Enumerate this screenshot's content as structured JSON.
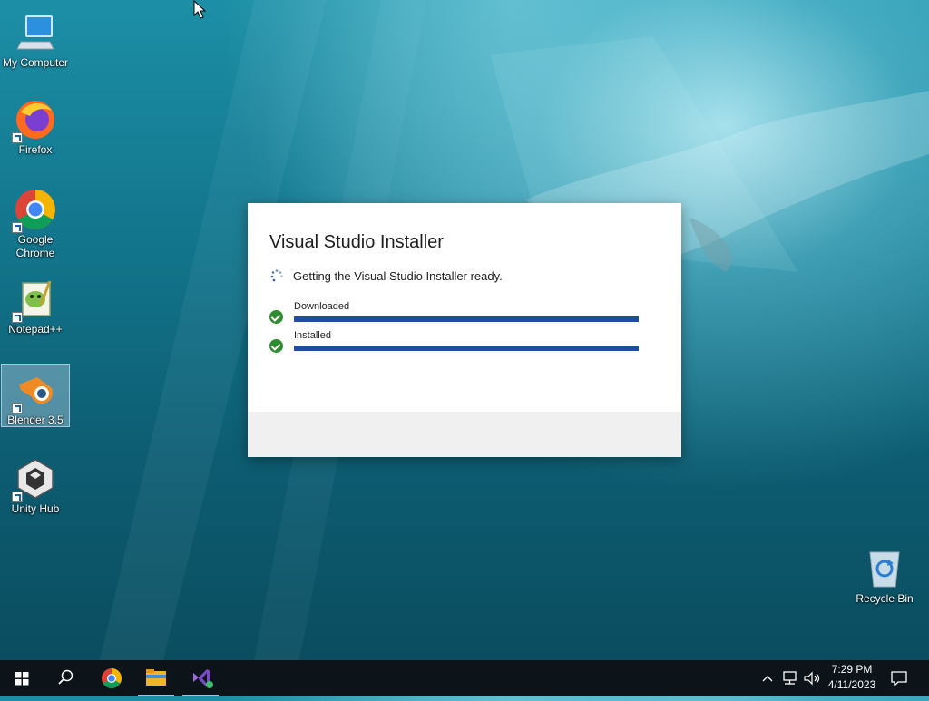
{
  "desktop": {
    "icons": [
      {
        "label": "My Computer",
        "icon": "computer-icon"
      },
      {
        "label": "Firefox",
        "icon": "firefox-icon"
      },
      {
        "label": "Google Chrome",
        "icon": "chrome-icon"
      },
      {
        "label": "Notepad++",
        "icon": "notepadpp-icon"
      },
      {
        "label": "Blender 3.5",
        "icon": "blender-icon"
      },
      {
        "label": "Unity Hub",
        "icon": "unity-hub-icon"
      },
      {
        "label": "Recycle Bin",
        "icon": "recycle-bin-icon"
      }
    ]
  },
  "installer": {
    "title": "Visual Studio Installer",
    "status": "Getting the Visual Studio Installer ready.",
    "steps": [
      {
        "label": "Downloaded",
        "progress": 1.0,
        "done": true
      },
      {
        "label": "Installed",
        "progress": 1.0,
        "done": true
      }
    ]
  },
  "taskbar": {
    "buttons": [
      "start-icon",
      "search-icon",
      "chrome-icon",
      "file-explorer-icon",
      "visual-studio-installer-icon"
    ],
    "clock": {
      "time": "7:29 PM",
      "date": "4/11/2023"
    }
  },
  "colors": {
    "progress_fill": "#1f4e9e",
    "check_green": "#2e8b2e",
    "taskbar_bg": "#0c1319"
  }
}
